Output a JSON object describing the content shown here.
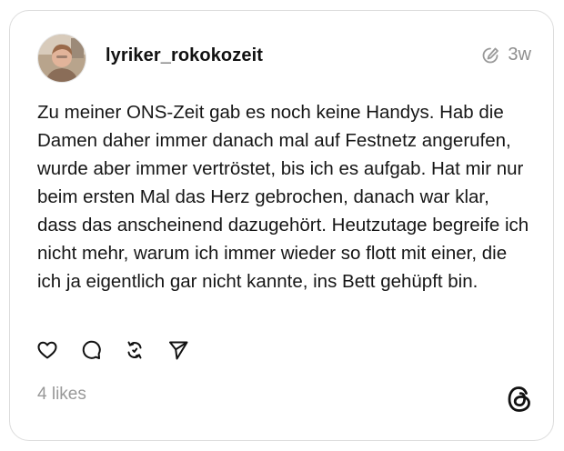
{
  "post": {
    "username": "lyriker_rokokozeit",
    "timestamp": "3w",
    "text": "Zu meiner ONS-Zeit gab es noch keine Handys. Hab die Damen daher immer danach mal auf Festnetz angerufen, wurde aber immer vertröstet, bis ich es aufgab. Hat mir nur beim ersten Mal das Herz gebrochen, danach war klar, dass das anscheinend dazugehört. Heutzutage begreife ich nicht mehr, warum ich immer wieder so flott mit einer, die ich ja eigentlich gar nicht kannte, ins Bett gehüpft bin.",
    "likes_label": "4 likes"
  },
  "icons": {
    "edited": "edited-icon",
    "like": "heart-icon",
    "reply": "comment-icon",
    "repost": "repost-icon",
    "share": "send-icon",
    "brand": "threads-logo-icon"
  },
  "colors": {
    "text": "#161616",
    "muted": "#8e8e8e",
    "border": "#dcdcdc"
  }
}
